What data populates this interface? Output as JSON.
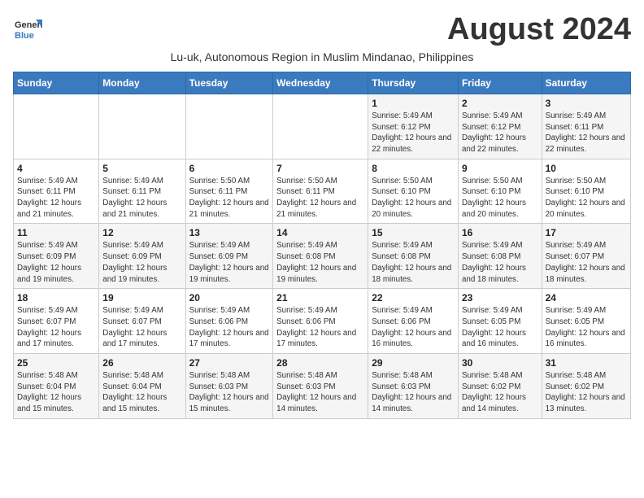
{
  "logo": {
    "line1": "General",
    "line2": "Blue"
  },
  "title": "August 2024",
  "subtitle": "Lu-uk, Autonomous Region in Muslim Mindanao, Philippines",
  "days_header": [
    "Sunday",
    "Monday",
    "Tuesday",
    "Wednesday",
    "Thursday",
    "Friday",
    "Saturday"
  ],
  "weeks": [
    [
      {
        "day": "",
        "sunrise": "",
        "sunset": "",
        "daylight": ""
      },
      {
        "day": "",
        "sunrise": "",
        "sunset": "",
        "daylight": ""
      },
      {
        "day": "",
        "sunrise": "",
        "sunset": "",
        "daylight": ""
      },
      {
        "day": "",
        "sunrise": "",
        "sunset": "",
        "daylight": ""
      },
      {
        "day": "1",
        "sunrise": "Sunrise: 5:49 AM",
        "sunset": "Sunset: 6:12 PM",
        "daylight": "Daylight: 12 hours and 22 minutes."
      },
      {
        "day": "2",
        "sunrise": "Sunrise: 5:49 AM",
        "sunset": "Sunset: 6:12 PM",
        "daylight": "Daylight: 12 hours and 22 minutes."
      },
      {
        "day": "3",
        "sunrise": "Sunrise: 5:49 AM",
        "sunset": "Sunset: 6:11 PM",
        "daylight": "Daylight: 12 hours and 22 minutes."
      }
    ],
    [
      {
        "day": "4",
        "sunrise": "Sunrise: 5:49 AM",
        "sunset": "Sunset: 6:11 PM",
        "daylight": "Daylight: 12 hours and 21 minutes."
      },
      {
        "day": "5",
        "sunrise": "Sunrise: 5:49 AM",
        "sunset": "Sunset: 6:11 PM",
        "daylight": "Daylight: 12 hours and 21 minutes."
      },
      {
        "day": "6",
        "sunrise": "Sunrise: 5:50 AM",
        "sunset": "Sunset: 6:11 PM",
        "daylight": "Daylight: 12 hours and 21 minutes."
      },
      {
        "day": "7",
        "sunrise": "Sunrise: 5:50 AM",
        "sunset": "Sunset: 6:11 PM",
        "daylight": "Daylight: 12 hours and 21 minutes."
      },
      {
        "day": "8",
        "sunrise": "Sunrise: 5:50 AM",
        "sunset": "Sunset: 6:10 PM",
        "daylight": "Daylight: 12 hours and 20 minutes."
      },
      {
        "day": "9",
        "sunrise": "Sunrise: 5:50 AM",
        "sunset": "Sunset: 6:10 PM",
        "daylight": "Daylight: 12 hours and 20 minutes."
      },
      {
        "day": "10",
        "sunrise": "Sunrise: 5:50 AM",
        "sunset": "Sunset: 6:10 PM",
        "daylight": "Daylight: 12 hours and 20 minutes."
      }
    ],
    [
      {
        "day": "11",
        "sunrise": "Sunrise: 5:49 AM",
        "sunset": "Sunset: 6:09 PM",
        "daylight": "Daylight: 12 hours and 19 minutes."
      },
      {
        "day": "12",
        "sunrise": "Sunrise: 5:49 AM",
        "sunset": "Sunset: 6:09 PM",
        "daylight": "Daylight: 12 hours and 19 minutes."
      },
      {
        "day": "13",
        "sunrise": "Sunrise: 5:49 AM",
        "sunset": "Sunset: 6:09 PM",
        "daylight": "Daylight: 12 hours and 19 minutes."
      },
      {
        "day": "14",
        "sunrise": "Sunrise: 5:49 AM",
        "sunset": "Sunset: 6:08 PM",
        "daylight": "Daylight: 12 hours and 19 minutes."
      },
      {
        "day": "15",
        "sunrise": "Sunrise: 5:49 AM",
        "sunset": "Sunset: 6:08 PM",
        "daylight": "Daylight: 12 hours and 18 minutes."
      },
      {
        "day": "16",
        "sunrise": "Sunrise: 5:49 AM",
        "sunset": "Sunset: 6:08 PM",
        "daylight": "Daylight: 12 hours and 18 minutes."
      },
      {
        "day": "17",
        "sunrise": "Sunrise: 5:49 AM",
        "sunset": "Sunset: 6:07 PM",
        "daylight": "Daylight: 12 hours and 18 minutes."
      }
    ],
    [
      {
        "day": "18",
        "sunrise": "Sunrise: 5:49 AM",
        "sunset": "Sunset: 6:07 PM",
        "daylight": "Daylight: 12 hours and 17 minutes."
      },
      {
        "day": "19",
        "sunrise": "Sunrise: 5:49 AM",
        "sunset": "Sunset: 6:07 PM",
        "daylight": "Daylight: 12 hours and 17 minutes."
      },
      {
        "day": "20",
        "sunrise": "Sunrise: 5:49 AM",
        "sunset": "Sunset: 6:06 PM",
        "daylight": "Daylight: 12 hours and 17 minutes."
      },
      {
        "day": "21",
        "sunrise": "Sunrise: 5:49 AM",
        "sunset": "Sunset: 6:06 PM",
        "daylight": "Daylight: 12 hours and 17 minutes."
      },
      {
        "day": "22",
        "sunrise": "Sunrise: 5:49 AM",
        "sunset": "Sunset: 6:06 PM",
        "daylight": "Daylight: 12 hours and 16 minutes."
      },
      {
        "day": "23",
        "sunrise": "Sunrise: 5:49 AM",
        "sunset": "Sunset: 6:05 PM",
        "daylight": "Daylight: 12 hours and 16 minutes."
      },
      {
        "day": "24",
        "sunrise": "Sunrise: 5:49 AM",
        "sunset": "Sunset: 6:05 PM",
        "daylight": "Daylight: 12 hours and 16 minutes."
      }
    ],
    [
      {
        "day": "25",
        "sunrise": "Sunrise: 5:48 AM",
        "sunset": "Sunset: 6:04 PM",
        "daylight": "Daylight: 12 hours and 15 minutes."
      },
      {
        "day": "26",
        "sunrise": "Sunrise: 5:48 AM",
        "sunset": "Sunset: 6:04 PM",
        "daylight": "Daylight: 12 hours and 15 minutes."
      },
      {
        "day": "27",
        "sunrise": "Sunrise: 5:48 AM",
        "sunset": "Sunset: 6:03 PM",
        "daylight": "Daylight: 12 hours and 15 minutes."
      },
      {
        "day": "28",
        "sunrise": "Sunrise: 5:48 AM",
        "sunset": "Sunset: 6:03 PM",
        "daylight": "Daylight: 12 hours and 14 minutes."
      },
      {
        "day": "29",
        "sunrise": "Sunrise: 5:48 AM",
        "sunset": "Sunset: 6:03 PM",
        "daylight": "Daylight: 12 hours and 14 minutes."
      },
      {
        "day": "30",
        "sunrise": "Sunrise: 5:48 AM",
        "sunset": "Sunset: 6:02 PM",
        "daylight": "Daylight: 12 hours and 14 minutes."
      },
      {
        "day": "31",
        "sunrise": "Sunrise: 5:48 AM",
        "sunset": "Sunset: 6:02 PM",
        "daylight": "Daylight: 12 hours and 13 minutes."
      }
    ]
  ]
}
